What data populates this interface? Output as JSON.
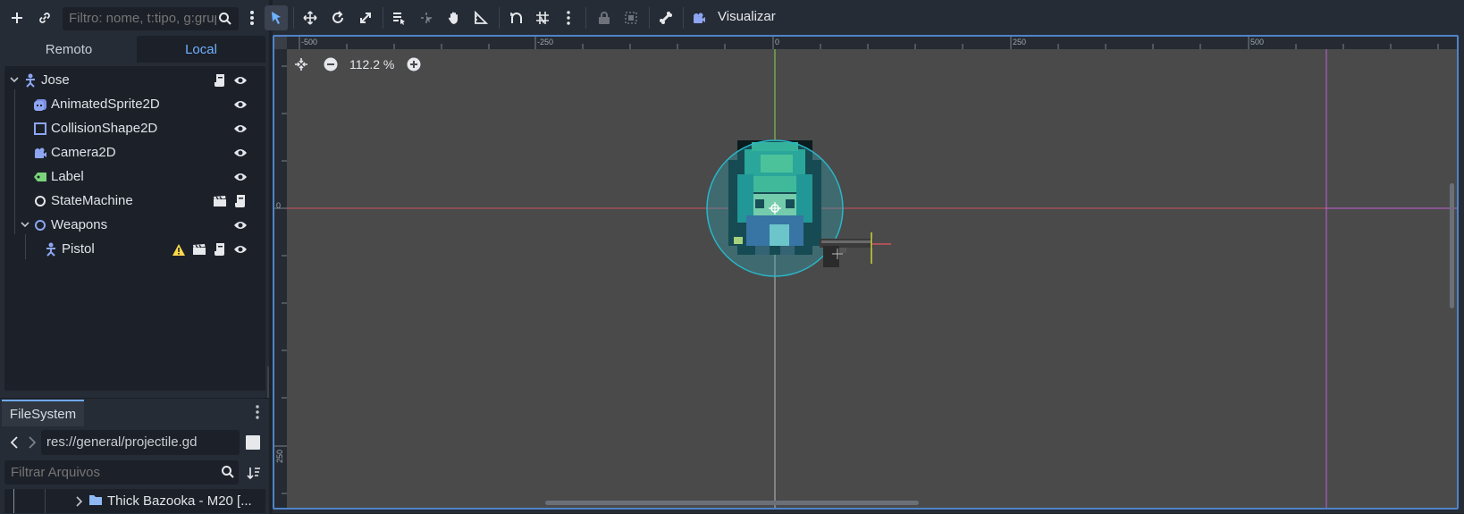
{
  "scene_dock": {
    "filter_placeholder": "Filtro: nome, t:tipo, g:grupo",
    "tabs": {
      "remote": "Remoto",
      "local": "Local"
    },
    "nodes": [
      {
        "name": "Jose",
        "icon": "character-body-icon"
      },
      {
        "name": "AnimatedSprite2D",
        "icon": "animated-sprite-icon"
      },
      {
        "name": "CollisionShape2D",
        "icon": "collision-shape-icon"
      },
      {
        "name": "Camera2D",
        "icon": "camera-icon"
      },
      {
        "name": "Label",
        "icon": "label-icon"
      },
      {
        "name": "StateMachine",
        "icon": "node-icon"
      },
      {
        "name": "Weapons",
        "icon": "node2d-icon"
      },
      {
        "name": "Pistol",
        "icon": "character-body-icon"
      }
    ]
  },
  "filesystem": {
    "tab": "FileSystem",
    "path": "res://general/projectile.gd",
    "filter_placeholder": "Filtrar Arquivos",
    "visible_item": "Thick Bazooka - M20 [..."
  },
  "toolbar": {
    "view_menu": "Visualizar"
  },
  "viewport": {
    "zoom": "112.2 %",
    "ruler_h_ticks": [
      "-500",
      "-250",
      "0",
      "250",
      "500"
    ],
    "ruler_v_ticks": [
      "0",
      "250"
    ]
  },
  "colors": {
    "accent": "#4f84c8",
    "tab_active": "#6fb0ff",
    "x_axis": "#d0535d",
    "y_axis": "#8fd24a",
    "camera_limit": "#c062d6"
  }
}
